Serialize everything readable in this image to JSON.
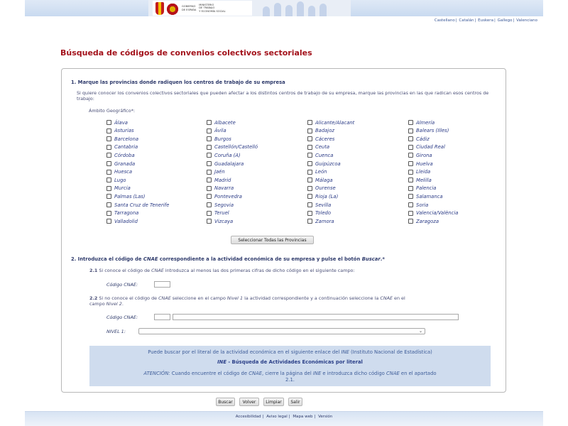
{
  "header": {
    "logo_text": [
      "GOBIERNO",
      "DE ESPAÑA",
      "MINISTERIO",
      "DE TRABAJO",
      "Y ECONOMÍA SOCIAL"
    ],
    "languages": [
      "Castellano",
      "Catalán",
      "Euskera",
      "Gallego",
      "Valenciano"
    ]
  },
  "title": "Búsqueda de códigos de convenios colectivos sectoriales",
  "section1": {
    "heading": "1. Marque las provincias donde radiquen los centros de trabajo de su empresa",
    "text": "Si quiere conocer los convenios colectivos sectoriales que pueden afectar a los distintos centros de trabajo de su empresa, marque las provincias en las que radican esos centros de trabajo:",
    "ambito_label": "Ámbito Geográfico*:",
    "provinces": [
      [
        "Álava",
        "Albacete",
        "Alicante/Alacant",
        "Almería"
      ],
      [
        "Asturias",
        "Ávila",
        "Badajoz",
        "Balears (Illes)"
      ],
      [
        "Barcelona",
        "Burgos",
        "Cáceres",
        "Cádiz"
      ],
      [
        "Cantabria",
        "Castellón/Castelló",
        "Ceuta",
        "Ciudad Real"
      ],
      [
        "Córdoba",
        "Coruña (A)",
        "Cuenca",
        "Girona"
      ],
      [
        "Granada",
        "Guadalajara",
        "Guipúzcoa",
        "Huelva"
      ],
      [
        "Huesca",
        "Jaén",
        "León",
        "Lleida"
      ],
      [
        "Lugo",
        "Madrid",
        "Málaga",
        "Melilla"
      ],
      [
        "Murcia",
        "Navarra",
        "Ourense",
        "Palencia"
      ],
      [
        "Palmas (Las)",
        "Pontevedra",
        "Rioja (La)",
        "Salamanca"
      ],
      [
        "Santa Cruz de Tenerife",
        "Segovia",
        "Sevilla",
        "Soria"
      ],
      [
        "Tarragona",
        "Teruel",
        "Toledo",
        "Valencia/València"
      ],
      [
        "Valladolid",
        "Vizcaya",
        "Zamora",
        "Zaragoza"
      ]
    ],
    "select_all_button": "Seleccionar Todas las Provincias"
  },
  "section2": {
    "heading_a": "2. Introduzca el código de ",
    "heading_cnae": "CNAE",
    "heading_b": " correspondiente a la actividad económica de su empresa y pulse el botón ",
    "heading_buscar": "Buscar",
    "heading_c": ".*",
    "sub1_num": "2.1",
    "sub1_a": " Si conoce el código de ",
    "sub1_cnae": "CNAE",
    "sub1_b": " introduzca al menos las dos primeras cifras de dicho código en el siguiente campo:",
    "codigo_label_1": "Código CNAE:",
    "sub2_num": "2.2",
    "sub2_a": " Si no conoce el código de ",
    "sub2_cnae": "CNAE",
    "sub2_b": " seleccione en el campo ",
    "sub2_nivel": "Nivel 1",
    "sub2_c": " la actividad correspondiente y a continuación seleccione la ",
    "sub2_cnae2": "CNAE",
    "sub2_d": " en el",
    "sub2_line2_a": "campo ",
    "sub2_line2_nivel": "Nivel 2",
    "sub2_line2_b": ".",
    "codigo_label_2": "Código CNAE:",
    "nivel_label": "NIVEL 1:",
    "nivel_value": ""
  },
  "info": {
    "line1_a": "Puede buscar por el literal de la actividad económica en el siguiente enlace del ",
    "line1_ine": "INE",
    "line1_b": " (Instituto Nacional de Estadística)",
    "link_ine": "INE",
    "link_text": " - Búsqueda de Actividades Económicas por literal",
    "atencion": "ATENCIÓN:",
    "att_a": " Cuando encuentre el código de ",
    "att_cnae": "CNAE",
    "att_b": ", cierre la página del ",
    "att_ine": "INE",
    "att_c": " e introduzca dicho código ",
    "att_cnae2": "CNAE",
    "att_d": " en el apartado",
    "att_line2": "2.1."
  },
  "actions": {
    "buscar": "Buscar",
    "volver": "Volver",
    "limpiar": "Limpiar",
    "salir": "Salir"
  },
  "footer": {
    "links": [
      "Accesibilidad",
      "Aviso legal",
      "Mapa web",
      "Versión"
    ]
  }
}
